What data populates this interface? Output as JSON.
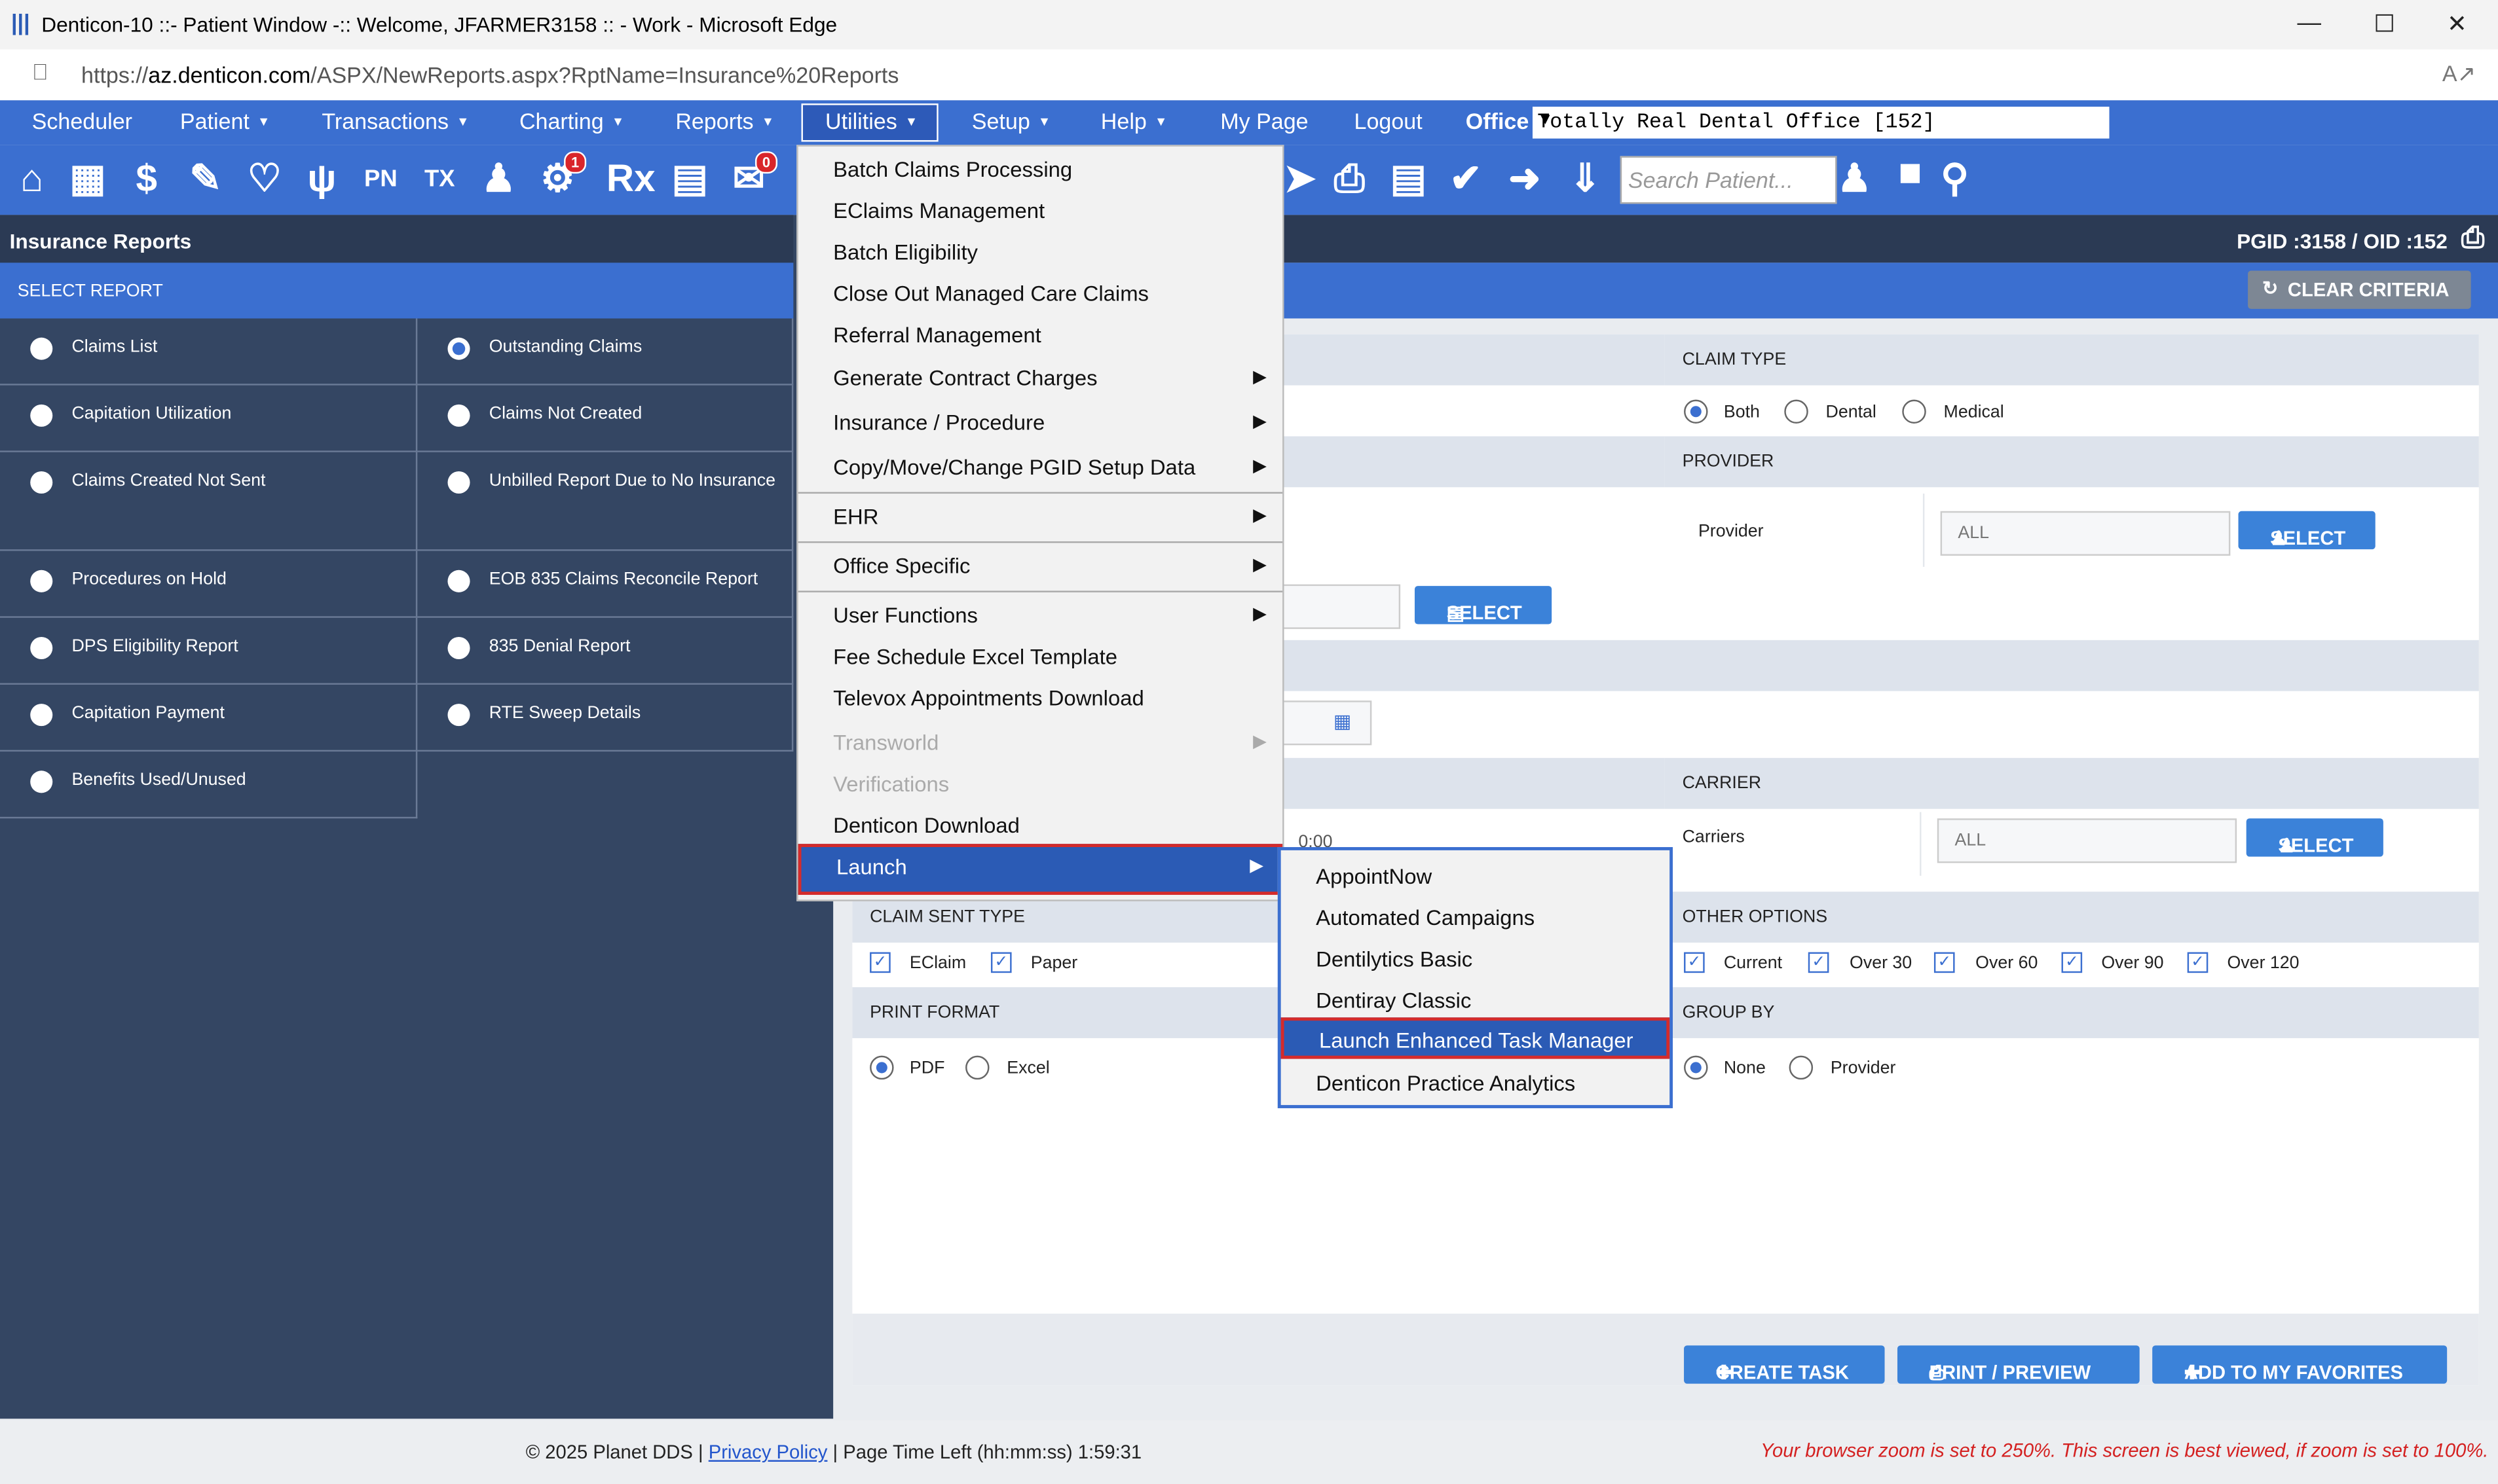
{
  "window": {
    "title": "Denticon-10 ::- Patient Window -:: Welcome, JFARMER3158 :: - Work - Microsoft Edge",
    "url_prefix": "https://",
    "url_domain": "az.denticon.com",
    "url_path": "/ASPX/NewReports.aspx?RptName=Insurance%20Reports"
  },
  "nav": {
    "items": [
      "Scheduler",
      "Patient",
      "Transactions",
      "Charting",
      "Reports",
      "Utilities",
      "Setup",
      "Help",
      "My Page",
      "Logout"
    ],
    "office_label": "Office",
    "office_value": "Totally Real Dental Office [152]"
  },
  "toolbar": {
    "search_placeholder": "Search Patient...",
    "badge_globe": "1",
    "badge_messages": "0",
    "pn_label": "PN",
    "tx_label": "TX",
    "rx_label": "Rx"
  },
  "left_panel": {
    "title": "Insurance Reports",
    "select_report": "SELECT REPORT",
    "reports_col1": [
      "Claims List",
      "Capitation Utilization",
      "Claims Created Not Sent",
      "Procedures on Hold",
      "DPS Eligibility Report",
      "Capitation Payment",
      "Benefits Used/Unused"
    ],
    "reports_col2": [
      "Outstanding Claims",
      "Claims Not Created",
      "Unbilled Report Due to No Insurance",
      "EOB 835 Claims Reconcile Report",
      "835 Denial Report",
      "RTE Sweep Details"
    ],
    "selected_report": "Outstanding Claims"
  },
  "header": {
    "pgid": "PGID :3158",
    "sep": "/",
    "oid": "OID :152",
    "clear_criteria": "CLEAR CRITERIA"
  },
  "form": {
    "claim_type_label": "CLAIM TYPE",
    "claim_type_options": [
      "Both",
      "Dental",
      "Medical"
    ],
    "provider_label": "PROVIDER",
    "provider_field_label": "Provider",
    "provider_value": "ALL",
    "select_label": "SELECT",
    "carrier_label": "CARRIER",
    "carriers_field_label": "Carriers",
    "carriers_value": "ALL",
    "claim_sent_type_label": "CLAIM SENT TYPE",
    "claim_sent_options": [
      "EClaim",
      "Paper"
    ],
    "print_format_label": "PRINT FORMAT",
    "print_format_options": [
      "PDF",
      "Excel"
    ],
    "other_options_label": "OTHER OPTIONS",
    "other_options": [
      "Current",
      "Over 30",
      "Over 60",
      "Over 90",
      "Over 120"
    ],
    "group_by_label": "GROUP BY",
    "group_by_options": [
      "None",
      "Provider"
    ],
    "partial_time": "0:00"
  },
  "actions": {
    "create_task": "CREATE TASK",
    "print_preview": "PRINT / PREVIEW",
    "add_favorites": "ADD TO MY FAVORITES"
  },
  "utilities_menu": {
    "items": [
      {
        "label": "Batch Claims Processing",
        "arrow": false,
        "disabled": false
      },
      {
        "label": "EClaims Management",
        "arrow": false,
        "disabled": false
      },
      {
        "label": "Batch Eligibility",
        "arrow": false,
        "disabled": false
      },
      {
        "label": "Close Out Managed Care Claims",
        "arrow": false,
        "disabled": false
      },
      {
        "label": "Referral Management",
        "arrow": false,
        "disabled": false
      },
      {
        "label": "Generate Contract Charges",
        "arrow": true,
        "disabled": false
      },
      {
        "label": "Insurance / Procedure",
        "arrow": true,
        "disabled": false
      },
      {
        "label": "Copy/Move/Change PGID Setup Data",
        "arrow": true,
        "disabled": false
      },
      {
        "label": "EHR",
        "arrow": true,
        "disabled": false
      },
      {
        "label": "Office Specific",
        "arrow": true,
        "disabled": false
      },
      {
        "label": "User Functions",
        "arrow": true,
        "disabled": false
      },
      {
        "label": "Fee Schedule Excel Template",
        "arrow": false,
        "disabled": false
      },
      {
        "label": "Televox Appointments Download",
        "arrow": false,
        "disabled": false
      },
      {
        "label": "Transworld",
        "arrow": true,
        "disabled": true
      },
      {
        "label": "Verifications",
        "arrow": false,
        "disabled": true
      },
      {
        "label": "Denticon Download",
        "arrow": false,
        "disabled": false
      },
      {
        "label": "Launch",
        "arrow": true,
        "disabled": false
      }
    ]
  },
  "launch_submenu": {
    "items": [
      "AppointNow",
      "Automated Campaigns",
      "Dentilytics Basic",
      "Dentiray Classic",
      "Launch Enhanced Task Manager",
      "Denticon Practice Analytics"
    ],
    "highlighted": "Launch Enhanced Task Manager"
  },
  "footer": {
    "copyright": "© 2025 Planet DDS",
    "pipe": "|",
    "privacy": "Privacy Policy",
    "page_time": "Page Time Left (hh:mm:ss) 1:59:31",
    "zoom_warning": "Your browser zoom is set to 250%. This screen is best viewed, if zoom is set to 100%."
  },
  "colors": {
    "nav_blue": "#3b6fd0",
    "panel_dark": "#344663",
    "highlight": "#2b5bb5",
    "red_outline": "#d42b2b"
  }
}
